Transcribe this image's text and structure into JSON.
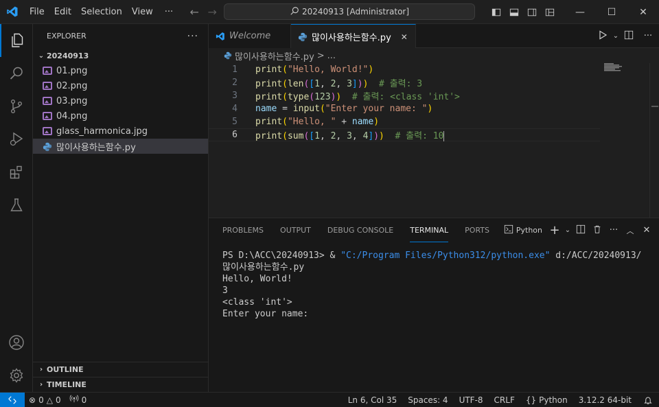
{
  "titlebar": {
    "menus": [
      "File",
      "Edit",
      "Selection",
      "View"
    ],
    "more": "···",
    "command_center": "20240913 [Administrator]",
    "icons": [
      "vscode-logo-icon",
      "back-arrow-icon",
      "forward-arrow-icon",
      "search-icon",
      "toggle-primary-sidebar-icon",
      "toggle-panel-icon",
      "toggle-secondary-sidebar-icon",
      "customize-layout-icon",
      "minimize-icon",
      "maximize-icon",
      "close-icon"
    ]
  },
  "activity_bar": {
    "items": [
      "explorer-icon",
      "search-icon",
      "source-control-icon",
      "run-debug-icon",
      "extensions-icon",
      "testing-icon"
    ],
    "bottom": [
      "accounts-icon",
      "manage-gear-icon"
    ]
  },
  "explorer": {
    "header": "EXPLORER",
    "folder": "20240913",
    "files": [
      {
        "name": "01.png",
        "type": "image"
      },
      {
        "name": "02.png",
        "type": "image"
      },
      {
        "name": "03.png",
        "type": "image"
      },
      {
        "name": "04.png",
        "type": "image"
      },
      {
        "name": "glass_harmonica.jpg",
        "type": "image"
      },
      {
        "name": "많이사용하는함수.py",
        "type": "python",
        "selected": true
      }
    ],
    "outline": "OUTLINE",
    "timeline": "TIMELINE"
  },
  "tabs": [
    {
      "label": "Welcome",
      "active": false
    },
    {
      "label": "많이사용하는함수.py",
      "active": true
    }
  ],
  "breadcrumb": {
    "file": "많이사용하는함수.py",
    "sep": ">",
    "rest": "..."
  },
  "editor": {
    "line_numbers": [
      "1",
      "2",
      "3",
      "4",
      "5",
      "6"
    ],
    "current_line": 6,
    "lines": [
      "print(\"Hello, World!\")",
      "print(len([1, 2, 3]))  # 출력: 3",
      "print(type(123))  # 출력: <class 'int'>",
      "name = input(\"Enter your name: \")",
      "print(\"Hello, \" + name)",
      "print(sum([1, 2, 3, 4]))  # 출력: 10"
    ]
  },
  "panel": {
    "tabs": [
      "PROBLEMS",
      "OUTPUT",
      "DEBUG CONSOLE",
      "TERMINAL",
      "PORTS"
    ],
    "active_tab": "TERMINAL",
    "terminal_profile": "Python",
    "terminal_lines": [
      {
        "prompt": "PS D:\\ACC\\20240913> & ",
        "path": "\"C:/Program Files/Python312/python.exe\"",
        "rest": " d:/ACC/20240913/많이사용하는함수.py"
      },
      "Hello, World!",
      "3",
      "<class 'int'>",
      "Enter your name: "
    ]
  },
  "statusbar": {
    "errors": "0",
    "warnings": "0",
    "ports": "0",
    "position": "Ln 6, Col 35",
    "spaces": "Spaces: 4",
    "encoding": "UTF-8",
    "eol": "CRLF",
    "language": "Python",
    "interpreter": "3.12.2 64-bit"
  },
  "colors": {
    "accent": "#0078d4",
    "background": "#1f1f1f",
    "sidebar": "#181818"
  }
}
